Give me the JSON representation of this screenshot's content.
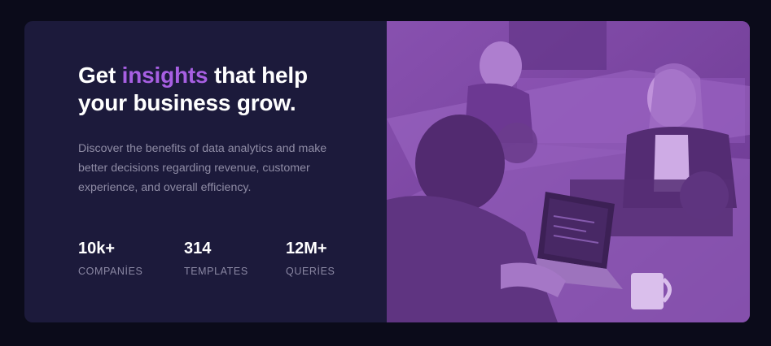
{
  "hero": {
    "headline_before": "Get ",
    "headline_accent": "insights",
    "headline_after": " that help your business grow.",
    "description": "Discover the benefits of data analytics and make better decisions regarding revenue, customer experience, and overall efficiency."
  },
  "stats": [
    {
      "value": "10k+",
      "label": "COMPANİES"
    },
    {
      "value": "314",
      "label": "TEMPLATES"
    },
    {
      "value": "12M+",
      "label": "QUERİES"
    }
  ],
  "colors": {
    "page_bg": "#0b0b1a",
    "card_bg": "#1c1a3b",
    "accent": "#a75fe2",
    "text_primary": "#ffffff",
    "text_muted": "#8f8ca5",
    "image_tint": "#6b3e8d"
  }
}
